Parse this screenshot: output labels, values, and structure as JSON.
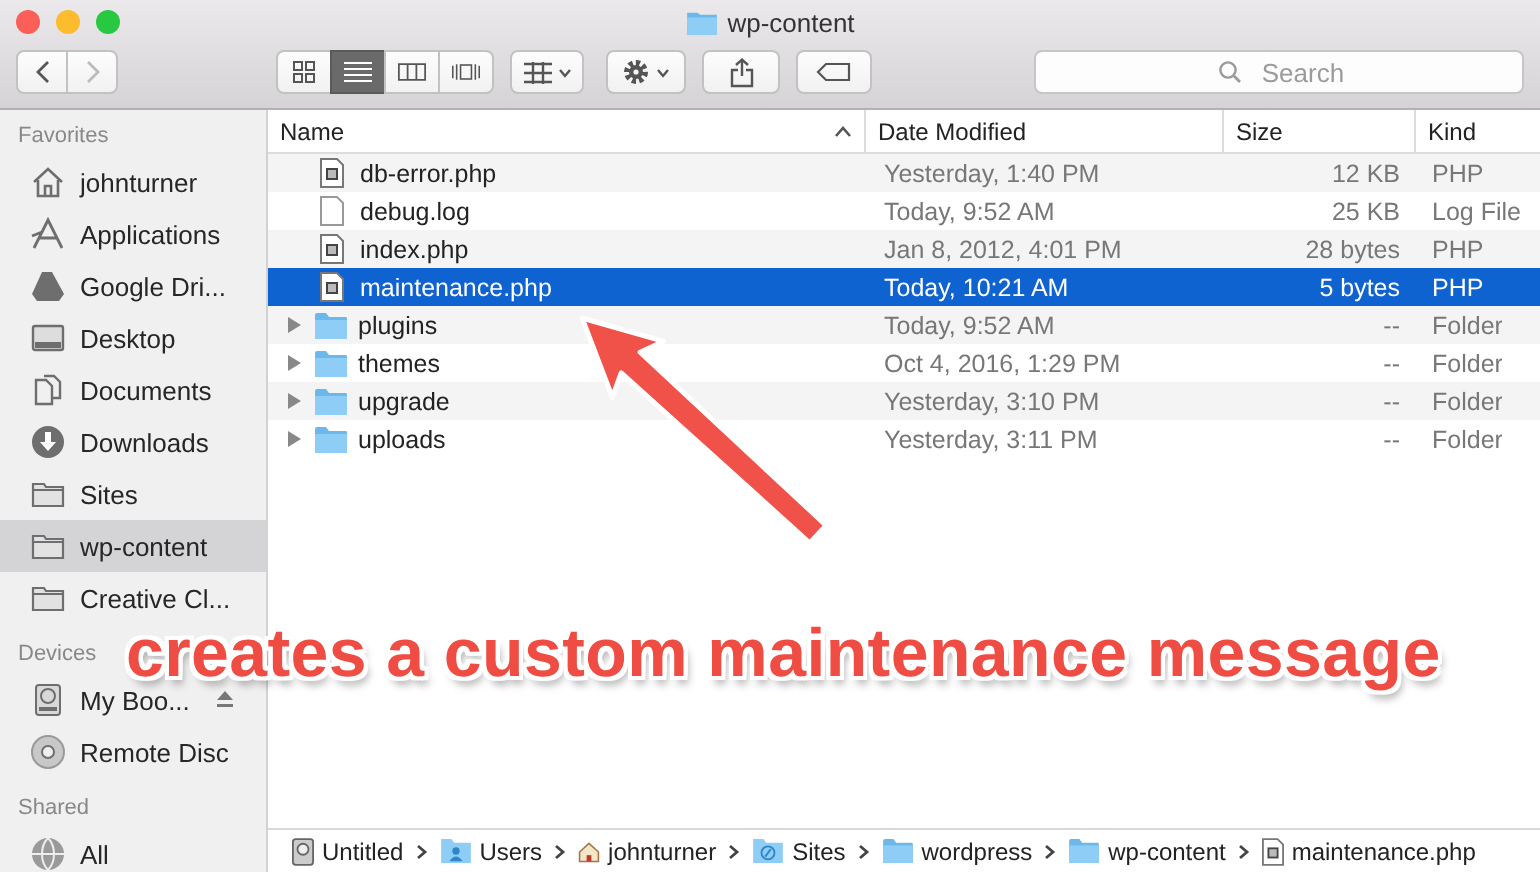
{
  "window": {
    "title": "wp-content"
  },
  "toolbar": {
    "view_modes": [
      {
        "kind": "icons",
        "selected": false
      },
      {
        "kind": "list",
        "selected": true
      },
      {
        "kind": "columns",
        "selected": false
      },
      {
        "kind": "coverflow",
        "selected": false
      }
    ],
    "search": {
      "placeholder": "Search"
    }
  },
  "sidebar": {
    "sections": [
      {
        "title": "Favorites",
        "items": [
          {
            "label": "johnturner",
            "kind": "home",
            "selected": false
          },
          {
            "label": "Applications",
            "kind": "apps",
            "selected": false
          },
          {
            "label": "Google Dri...",
            "kind": "drive",
            "selected": false
          },
          {
            "label": "Desktop",
            "kind": "desktop",
            "selected": false
          },
          {
            "label": "Documents",
            "kind": "documents",
            "selected": false
          },
          {
            "label": "Downloads",
            "kind": "downloads",
            "selected": false
          },
          {
            "label": "Sites",
            "kind": "folder",
            "selected": false
          },
          {
            "label": "wp-content",
            "kind": "folder",
            "selected": true
          },
          {
            "label": "Creative Cl...",
            "kind": "folder",
            "selected": false
          }
        ]
      },
      {
        "title": "Devices",
        "items": [
          {
            "label": "My Boo...",
            "kind": "harddisk",
            "selected": false,
            "ejectable": true
          },
          {
            "label": "Remote Disc",
            "kind": "disc",
            "selected": false
          }
        ]
      },
      {
        "title": "Shared",
        "items": [
          {
            "label": "All",
            "kind": "network",
            "selected": false
          }
        ]
      }
    ]
  },
  "table": {
    "columns": [
      {
        "label": "Name",
        "sorted": true
      },
      {
        "label": "Date Modified",
        "sorted": false
      },
      {
        "label": "Size",
        "sorted": false
      },
      {
        "label": "Kind",
        "sorted": false
      }
    ],
    "rows": [
      {
        "name": "db-error.php",
        "kind": "php",
        "date": "Yesterday, 1:40 PM",
        "size": "12 KB",
        "type": "PHP",
        "selected": false
      },
      {
        "name": "debug.log",
        "kind": "text",
        "date": "Today, 9:52 AM",
        "size": "25 KB",
        "type": "Log File",
        "selected": false
      },
      {
        "name": "index.php",
        "kind": "php",
        "date": "Jan 8, 2012, 4:01 PM",
        "size": "28 bytes",
        "type": "PHP",
        "selected": false
      },
      {
        "name": "maintenance.php",
        "kind": "php",
        "date": "Today, 10:21 AM",
        "size": "5 bytes",
        "type": "PHP",
        "selected": true
      },
      {
        "name": "plugins",
        "kind": "folder",
        "expanded": false,
        "date": "Today, 9:52 AM",
        "size": "--",
        "type": "Folder",
        "selected": false
      },
      {
        "name": "themes",
        "kind": "folder",
        "expanded": false,
        "date": "Oct 4, 2016, 1:29 PM",
        "size": "--",
        "type": "Folder",
        "selected": false
      },
      {
        "name": "upgrade",
        "kind": "folder",
        "expanded": false,
        "date": "Yesterday, 3:10 PM",
        "size": "--",
        "type": "Folder",
        "selected": false
      },
      {
        "name": "uploads",
        "kind": "folder",
        "expanded": false,
        "date": "Yesterday, 3:11 PM",
        "size": "--",
        "type": "Folder",
        "selected": false
      }
    ]
  },
  "path_bar": [
    {
      "label": "Untitled",
      "kind": "harddisk"
    },
    {
      "label": "Users",
      "kind": "users"
    },
    {
      "label": "johnturner",
      "kind": "home"
    },
    {
      "label": "Sites",
      "kind": "sites"
    },
    {
      "label": "wordpress",
      "kind": "folder"
    },
    {
      "label": "wp-content",
      "kind": "folder"
    },
    {
      "label": "maintenance.php",
      "kind": "php"
    }
  ],
  "annotation": {
    "text": "creates a custom maintenance message"
  }
}
